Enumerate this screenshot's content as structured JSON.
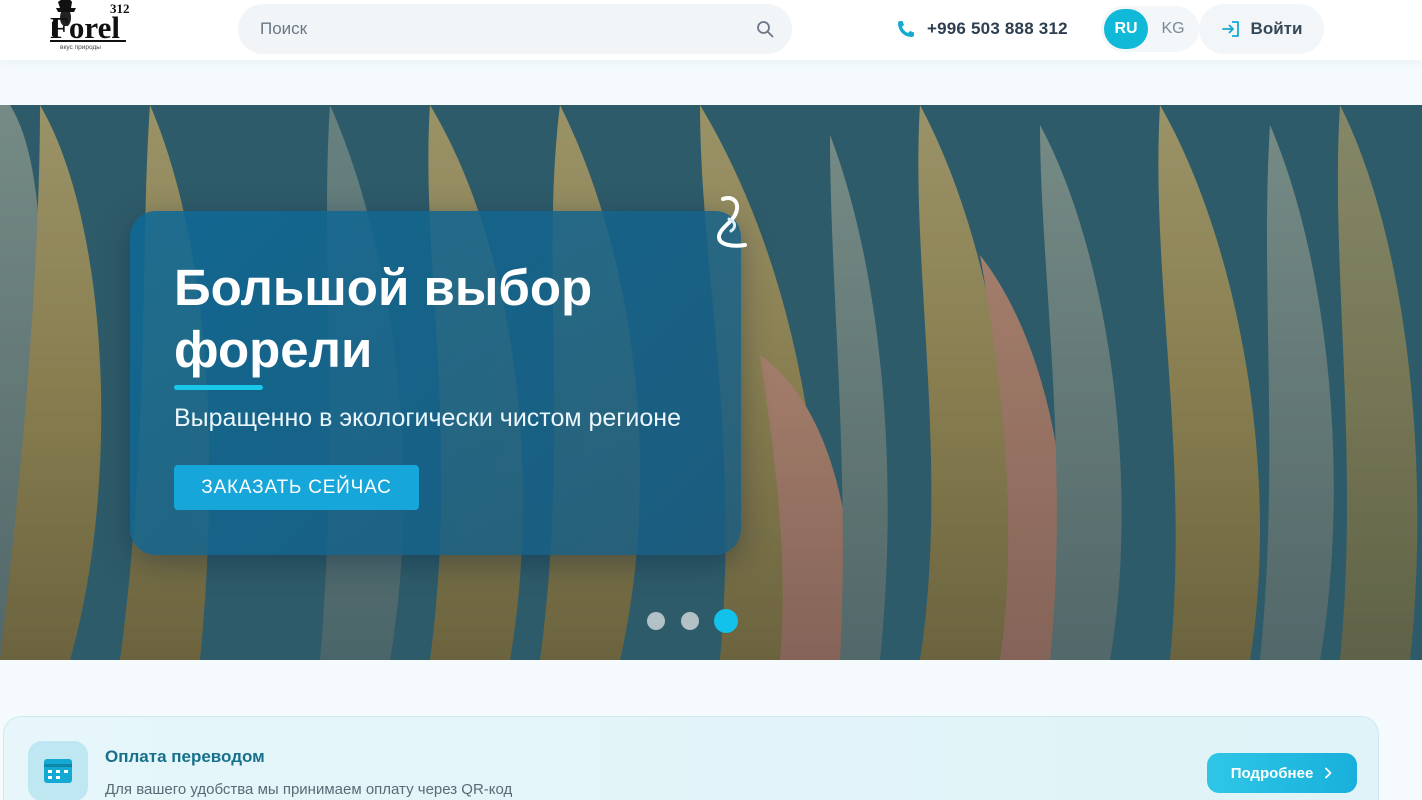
{
  "header": {
    "logo_text": "Forel",
    "logo_number": "312",
    "logo_tagline": "вкус природы",
    "search_placeholder": "Поиск",
    "phone": "+996 503 888 312",
    "languages": [
      "RU",
      "KG"
    ],
    "active_language": "RU",
    "login_label": "Войти"
  },
  "hero": {
    "title": "Большой выбор форели",
    "subtitle": "Выращенно в экологически чистом регионе",
    "cta_label": "ЗАКАЗАТЬ СЕЙЧАС",
    "slides_count": 3,
    "active_slide": 3
  },
  "payment": {
    "title": "Оплата переводом",
    "description": "Для вашего удобства мы принимаем оплату через QR-код",
    "more_label": "Подробнее"
  },
  "colors": {
    "accent": "#11b9d9",
    "cta": "#16a6d9",
    "payment_title": "#16708a"
  }
}
